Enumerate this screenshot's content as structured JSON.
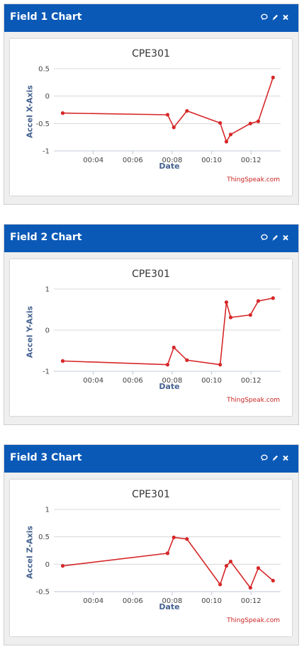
{
  "credit": "ThingSpeak.com",
  "panels": [
    {
      "header": "Field 1 Chart",
      "chart_title": "CPE301",
      "ylabel": "Accel X-Axis",
      "xlabel": "Date"
    },
    {
      "header": "Field 2 Chart",
      "chart_title": "CPE301",
      "ylabel": "Accel Y-Axis",
      "xlabel": "Date"
    },
    {
      "header": "Field 3 Chart",
      "chart_title": "CPE301",
      "ylabel": "Accel Z-Axis",
      "xlabel": "Date"
    }
  ],
  "chart_data": [
    {
      "type": "line",
      "title": "CPE301",
      "xlabel": "Date",
      "ylabel": "Accel X-Axis",
      "x_ticks": [
        "00:04",
        "00:06",
        "00:08",
        "00:10",
        "00:12"
      ],
      "y_ticks": [
        0.5,
        0,
        -0.5,
        -1
      ],
      "ylim": [
        -1,
        0.5
      ],
      "xlim": [
        "00:02:00",
        "00:13:30"
      ],
      "series": [
        {
          "color": "#d62728",
          "x": [
            "00:02:27",
            "00:07:46",
            "00:08:05",
            "00:08:45",
            "00:10:26",
            "00:10:45",
            "00:10:58",
            "00:11:58",
            "00:12:22",
            "00:13:07"
          ],
          "y": [
            -0.31,
            -0.34,
            -0.57,
            -0.27,
            -0.49,
            -0.83,
            -0.7,
            -0.5,
            -0.46,
            0.34
          ]
        }
      ],
      "grid": true
    },
    {
      "type": "line",
      "title": "CPE301",
      "xlabel": "Date",
      "ylabel": "Accel Y-Axis",
      "x_ticks": [
        "00:04",
        "00:06",
        "00:08",
        "00:10",
        "00:12"
      ],
      "y_ticks": [
        1,
        0,
        -1
      ],
      "ylim": [
        -1,
        1
      ],
      "xlim": [
        "00:02:00",
        "00:13:30"
      ],
      "series": [
        {
          "color": "#d62728",
          "x": [
            "00:02:27",
            "00:07:46",
            "00:08:05",
            "00:08:45",
            "00:10:26",
            "00:10:45",
            "00:10:58",
            "00:11:58",
            "00:12:22",
            "00:13:07"
          ],
          "y": [
            -0.75,
            -0.84,
            -0.42,
            -0.73,
            -0.84,
            0.68,
            0.31,
            0.37,
            0.71,
            0.78
          ]
        }
      ],
      "grid": true
    },
    {
      "type": "line",
      "title": "CPE301",
      "xlabel": "Date",
      "ylabel": "Accel Z-Axis",
      "x_ticks": [
        "00:04",
        "00:06",
        "00:08",
        "00:10",
        "00:12"
      ],
      "y_ticks": [
        1,
        0.5,
        0,
        -0.5
      ],
      "ylim": [
        -0.5,
        1
      ],
      "xlim": [
        "00:02:00",
        "00:13:30"
      ],
      "series": [
        {
          "color": "#d62728",
          "x": [
            "00:02:27",
            "00:07:46",
            "00:08:05",
            "00:08:45",
            "00:10:26",
            "00:10:45",
            "00:10:58",
            "00:11:58",
            "00:12:22",
            "00:13:07"
          ],
          "y": [
            -0.03,
            0.2,
            0.49,
            0.46,
            -0.37,
            -0.03,
            0.05,
            -0.43,
            -0.07,
            -0.3
          ]
        }
      ],
      "grid": true
    }
  ],
  "icons": [
    "comment-icon",
    "pencil-icon",
    "close-icon"
  ]
}
